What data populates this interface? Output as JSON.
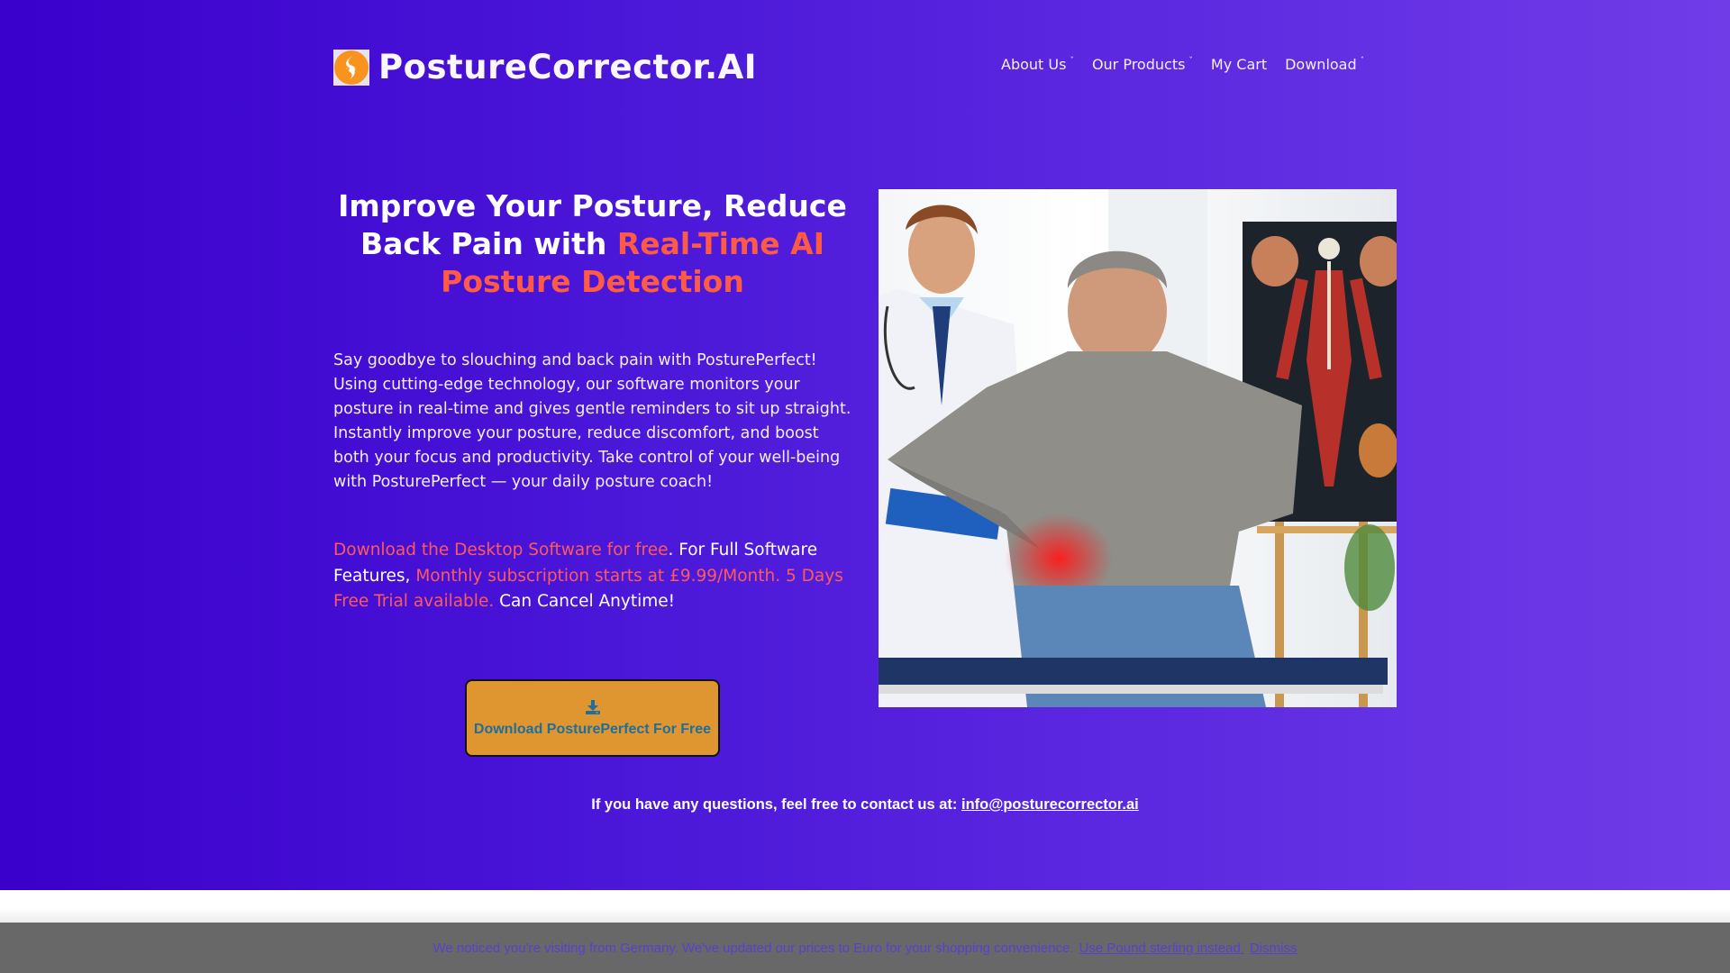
{
  "header": {
    "logo_icon": "spine-flame-icon",
    "brand": "PostureCorrector.AI",
    "nav": [
      {
        "label": "About Us",
        "has_dropdown": true
      },
      {
        "label": "Our Products",
        "has_dropdown": true
      },
      {
        "label": "My Cart",
        "has_dropdown": false
      },
      {
        "label": "Download",
        "has_dropdown": true
      }
    ],
    "chevron_glyph": "ˇ"
  },
  "hero": {
    "headline_white": "Improve Your Posture, Reduce Back Pain with ",
    "headline_accent": "Real-Time AI Posture Detection",
    "intro": "Say goodbye to slouching and back pain with PosturePerfect! Using cutting-edge technology, our software monitors your posture in real-time and gives gentle reminders to sit up straight. Instantly improve your posture, reduce discomfort, and boost both your focus and productivity. Take control of your well-being with PosturePerfect — your daily posture coach!",
    "offer": {
      "part1_highlight": "Download the Desktop Software for free",
      "part2": ". For Full Software Features, ",
      "part3_highlight": "Monthly subscription starts at £9.99/Month. 5 Days Free Trial available.",
      "part4": " Can Cancel Anytime!"
    },
    "download_button": {
      "icon": "download-icon",
      "label": "Download PosturePerfect For Free"
    },
    "image": {
      "alt": "Doctor with clipboard examining a man holding his lower back in pain, anatomy poster in background"
    },
    "contact": {
      "text": "If you have any questions, feel free to contact us at: ",
      "email": "info@posturecorrector.ai"
    }
  },
  "notice_bar": {
    "text": "We noticed you're visiting from Germany. We've updated our prices to Euro for your shopping convenience.",
    "link_use_pound": "Use Pound sterling instead.",
    "link_dismiss": "Dismiss"
  },
  "colors": {
    "gradient_start": "#3a00cc",
    "gradient_end": "#703ce8",
    "accent_red": "#ff5a45",
    "button_bg": "#df9530",
    "button_text": "#1f6f9a",
    "logo_orange": "#f7931e",
    "notice_bg": "#686868",
    "notice_text": "#5b3fd0"
  }
}
